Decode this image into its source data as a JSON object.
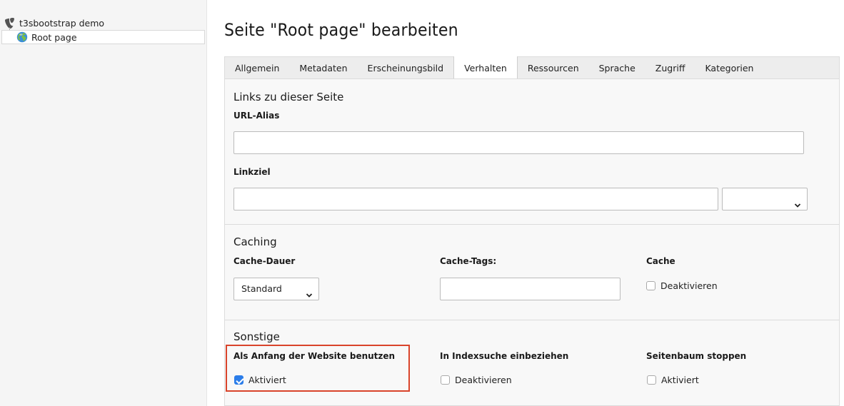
{
  "tree": {
    "root_label": "t3sbootstrap demo",
    "node_label": "Root page"
  },
  "header": {
    "title": "Seite \"Root page\" bearbeiten"
  },
  "tabs": [
    {
      "label": "Allgemein",
      "active": false
    },
    {
      "label": "Metadaten",
      "active": false
    },
    {
      "label": "Erscheinungsbild",
      "active": false
    },
    {
      "label": "Verhalten",
      "active": true
    },
    {
      "label": "Ressourcen",
      "active": false
    },
    {
      "label": "Sprache",
      "active": false
    },
    {
      "label": "Zugriff",
      "active": false
    },
    {
      "label": "Kategorien",
      "active": false
    }
  ],
  "links": {
    "heading": "Links zu dieser Seite",
    "url_alias_label": "URL-Alias",
    "url_alias_value": "",
    "linkziel_label": "Linkziel",
    "linkziel_value": "",
    "linkziel_select_value": ""
  },
  "caching": {
    "heading": "Caching",
    "cache_dauer_label": "Cache-Dauer",
    "cache_dauer_value": "Standard",
    "cache_tags_label": "Cache-Tags:",
    "cache_tags_value": "",
    "cache_label": "Cache",
    "cache_checkbox_label": "Deaktivieren",
    "cache_checked": false
  },
  "sonstige": {
    "heading": "Sonstige",
    "anfang_label": "Als Anfang der Website benutzen",
    "anfang_checkbox_label": "Aktiviert",
    "anfang_checked": true,
    "index_label": "In Indexsuche einbeziehen",
    "index_checkbox_label": "Deaktivieren",
    "index_checked": false,
    "stoppen_label": "Seitenbaum stoppen",
    "stoppen_checkbox_label": "Aktiviert",
    "stoppen_checked": false
  },
  "colors": {
    "highlight_border": "#d9442b",
    "checkbox_checked": "#2b7de9"
  }
}
